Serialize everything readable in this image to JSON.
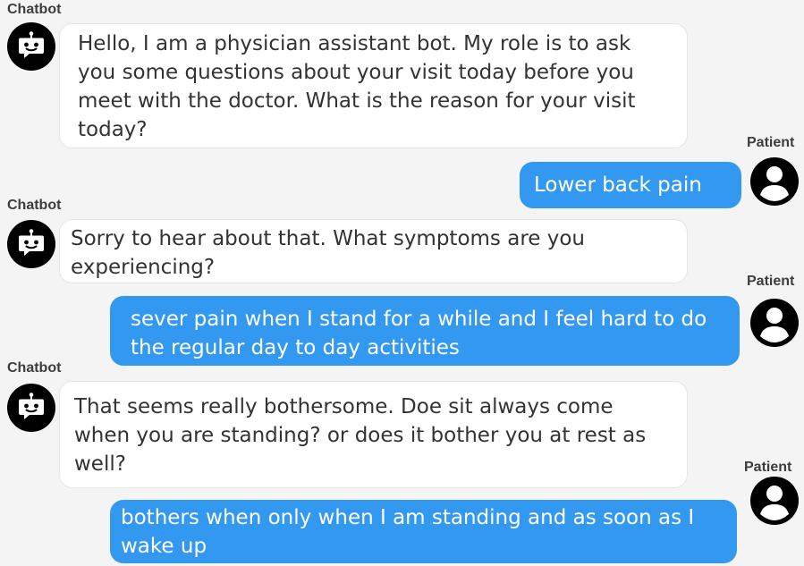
{
  "messages": [
    {
      "sender": "Chatbot",
      "role": "bot",
      "text": "Hello, I am a physician assistant bot. My role is to ask you some questions about your visit today before you meet with the doctor. What is the reason for your visit today?"
    },
    {
      "sender": "Patient",
      "role": "user",
      "text": "Lower back pain"
    },
    {
      "sender": "Chatbot",
      "role": "bot",
      "text": "Sorry to hear about that. What symptoms are you experiencing?"
    },
    {
      "sender": "Patient",
      "role": "user",
      "text": "sever pain when I stand for a while and I feel hard to do the regular day to day activities"
    },
    {
      "sender": "Chatbot",
      "role": "bot",
      "text": "That seems really bothersome. Doe sit always come when you are standing? or does it bother you at rest as well?"
    },
    {
      "sender": "Patient",
      "role": "user",
      "text": "bothers when only when I am standing and as soon as I wake up"
    }
  ],
  "icons": {
    "bot_avatar": "robot-icon",
    "user_avatar": "user-icon"
  },
  "colors": {
    "background": "#f4f4f4",
    "bot_bubble": "#ffffff",
    "user_bubble": "#3399f0",
    "avatar": "#000000"
  }
}
